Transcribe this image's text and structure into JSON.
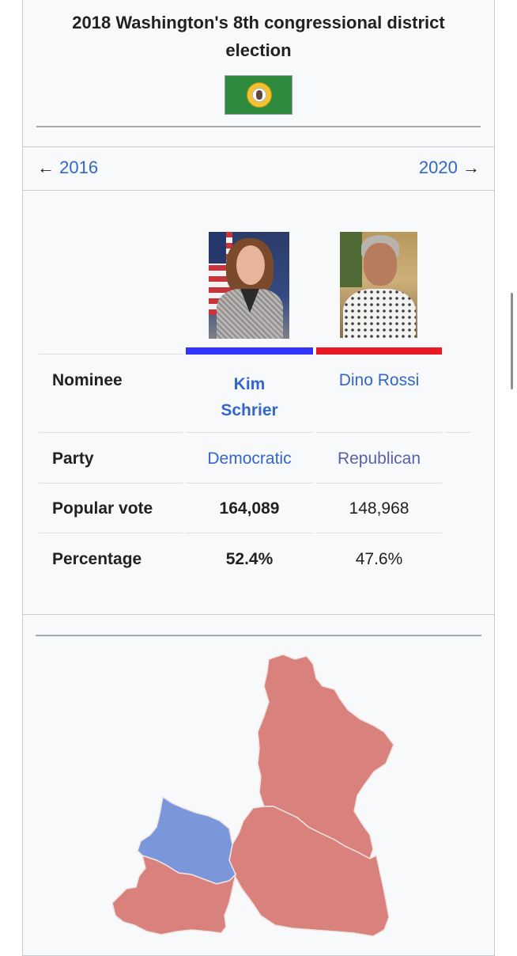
{
  "title": "2018 Washington's 8th congressional district election",
  "nav": {
    "prev_arrow": "←",
    "prev_year": "2016",
    "next_year": "2020",
    "next_arrow": "→"
  },
  "candidates": [
    {
      "name": "Kim Schrier",
      "party": "Democratic",
      "popular_vote": "164,089",
      "percentage": "52.4%",
      "color": "#3333ff"
    },
    {
      "name": "Dino Rossi",
      "party": "Republican",
      "popular_vote": "148,968",
      "percentage": "47.6%",
      "color": "#e81b23"
    }
  ],
  "rows": {
    "nominee": "Nominee",
    "party": "Party",
    "popular_vote": "Popular vote",
    "percentage": "Percentage"
  },
  "map": {
    "colors": {
      "democratic": "#7b97dc",
      "republican": "#d8817d",
      "border": "#f0e4e2"
    }
  }
}
